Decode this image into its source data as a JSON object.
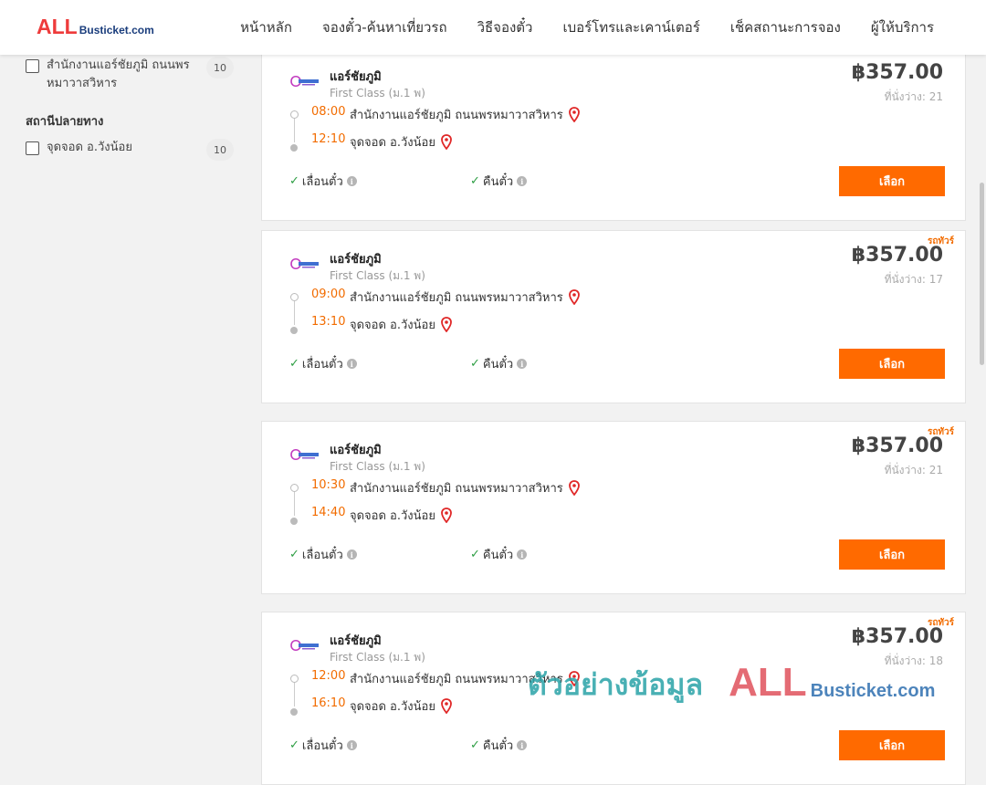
{
  "header": {
    "logo_all": "ALL",
    "logo_rest": "Busticket.com",
    "nav": [
      "หน้าหลัก",
      "จองตั๋ว-ค้นหาเที่ยวรถ",
      "วิธีจองตั๋ว",
      "เบอร์โทรและเคาน์เตอร์",
      "เช็คสถานะการจอง",
      "ผู้ให้บริการ"
    ]
  },
  "sidebar": {
    "origin_item": {
      "label": "สำนักงานแอร์ชัยภูมิ ถนนพรหมาวาสวิหาร",
      "count": "10"
    },
    "dest_title": "สถานีปลายทาง",
    "dest_item": {
      "label": "จุดจอด อ.วังน้อย",
      "count": "10"
    }
  },
  "colors": {
    "accent": "#ff6a00",
    "time": "#f26c00",
    "check": "#2e9e44"
  },
  "cards": [
    {
      "badge": "",
      "operator": "แอร์ชัยภูมิ",
      "class": "First Class (ม.1 พ)",
      "price": "฿357.00",
      "seats": "ที่นั่งว่าง: 21",
      "depart_time": "08:00",
      "depart_place": "สำนักงานแอร์ชัยภูมิ ถนนพรหมาวาสวิหาร",
      "arrive_time": "12:10",
      "arrive_place": "จุดจอด อ.วังน้อย",
      "feature1": "เลื่อนตั๋ว",
      "feature2": "คืนตั๋ว",
      "button": "เลือก"
    },
    {
      "badge": "รถทัวร์",
      "operator": "แอร์ชัยภูมิ",
      "class": "First Class (ม.1 พ)",
      "price": "฿357.00",
      "seats": "ที่นั่งว่าง: 17",
      "depart_time": "09:00",
      "depart_place": "สำนักงานแอร์ชัยภูมิ ถนนพรหมาวาสวิหาร",
      "arrive_time": "13:10",
      "arrive_place": "จุดจอด อ.วังน้อย",
      "feature1": "เลื่อนตั๋ว",
      "feature2": "คืนตั๋ว",
      "button": "เลือก"
    },
    {
      "badge": "รถทัวร์",
      "operator": "แอร์ชัยภูมิ",
      "class": "First Class (ม.1 พ)",
      "price": "฿357.00",
      "seats": "ที่นั่งว่าง: 21",
      "depart_time": "10:30",
      "depart_place": "สำนักงานแอร์ชัยภูมิ ถนนพรหมาวาสวิหาร",
      "arrive_time": "14:40",
      "arrive_place": "จุดจอด อ.วังน้อย",
      "feature1": "เลื่อนตั๋ว",
      "feature2": "คืนตั๋ว",
      "button": "เลือก"
    },
    {
      "badge": "รถทัวร์",
      "operator": "แอร์ชัยภูมิ",
      "class": "First Class (ม.1 พ)",
      "price": "฿357.00",
      "seats": "ที่นั่งว่าง: 18",
      "depart_time": "12:00",
      "depart_place": "สำนักงานแอร์ชัยภูมิ ถนนพรหมาวาสวิหาร",
      "arrive_time": "16:10",
      "arrive_place": "จุดจอด อ.วังน้อย",
      "feature1": "เลื่อนตั๋ว",
      "feature2": "คืนตั๋ว",
      "button": "เลือก"
    }
  ],
  "watermark": {
    "text": "ตัวอย่างข้อมูล",
    "all": "ALL",
    "rest": "Busticket.com"
  }
}
